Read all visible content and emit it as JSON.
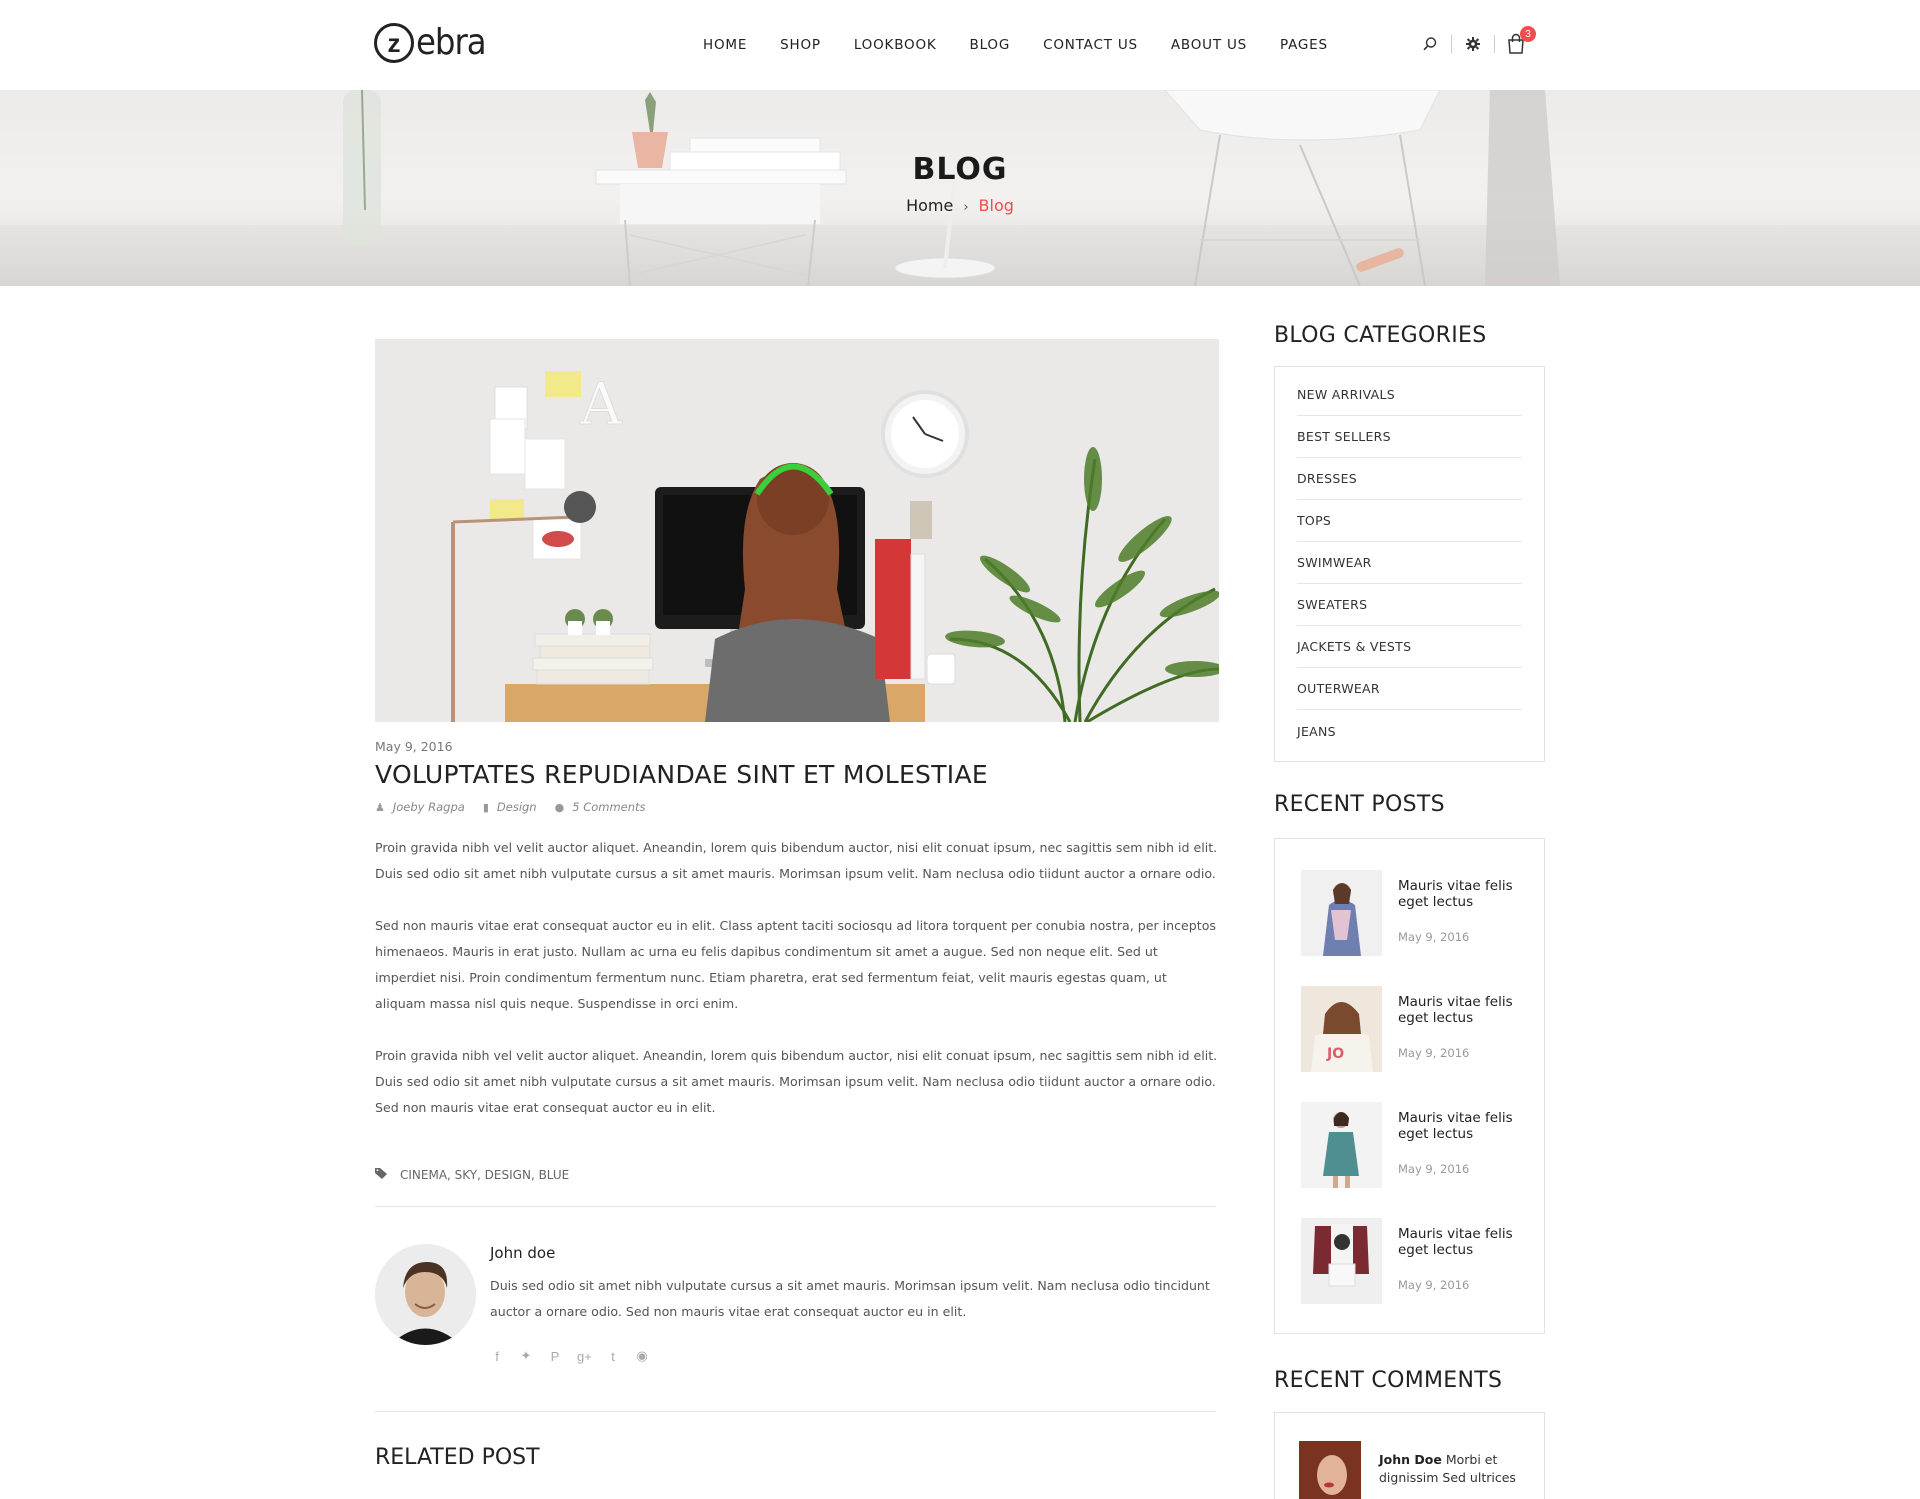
{
  "brand": {
    "logo_letter": "z",
    "logo_word": "ebra"
  },
  "nav": {
    "items": [
      "HOME",
      "SHOP",
      "LOOKBOOK",
      "BLOG",
      "CONTACT US",
      "ABOUT US",
      "PAGES"
    ]
  },
  "header_icons": {
    "search": "search-icon",
    "settings": "gear-icon",
    "cart": "cart-icon",
    "cart_count": "3"
  },
  "hero": {
    "title": "BLOG",
    "breadcrumb_home": "Home",
    "breadcrumb_sep": "›",
    "breadcrumb_current": "Blog"
  },
  "post": {
    "date": "May 9, 2016",
    "title": "VOLUPTATES REPUDIANDAE SINT ET MOLESTIAE",
    "author": "Joeby Ragpa",
    "category": "Design",
    "comments": "5 Comments",
    "paragraphs": [
      "Proin gravida nibh vel velit auctor aliquet. Aneandin, lorem quis bibendum auctor, nisi elit conuat ipsum, nec sagittis sem nibh id elit. Duis sed odio sit amet nibh vulputate cursus a sit amet mauris. Morimsan ipsum velit. Nam neclusa odio tiidunt auctor a ornare odio.",
      "Sed non  mauris vitae erat consequat auctor eu in elit. Class aptent taciti sociosqu ad litora torquent per conubia nostra, per inceptos himenaeos. Mauris in erat justo. Nullam ac urna eu felis dapibus condimentum sit amet a augue. Sed non neque elit. Sed ut imperdiet nisi. Proin condimentum fermentum nunc. Etiam pharetra, erat sed fermentum feiat, velit mauris egestas quam, ut aliquam massa nisl quis neque. Suspendisse in orci enim.",
      "Proin gravida nibh vel velit auctor aliquet. Aneandin, lorem quis bibendum auctor, nisi elit conuat ipsum, nec sagittis sem nibh id elit. Duis sed odio sit amet nibh vulputate cursus a sit amet mauris. Morimsan ipsum velit. Nam neclusa odio tiidunt auctor a ornare odio. Sed non mauris vitae erat consequat auctor eu in elit."
    ],
    "tags": "CINEMA, SKY, DESIGN, BLUE"
  },
  "author_box": {
    "name": "John doe",
    "bio": "Duis sed odio sit amet nibh vulputate cursus a sit amet mauris. Morimsan ipsum velit. Nam neclusa odio tincidunt auctor a ornare odio. Sed non  mauris vitae erat consequat auctor eu in elit.",
    "socials": [
      "facebook-icon",
      "twitter-icon",
      "pinterest-icon",
      "google-plus-icon",
      "tumblr-icon",
      "wordpress-icon"
    ]
  },
  "related": {
    "title": "RELATED POST"
  },
  "sidebar": {
    "categories_title": "BLOG CATEGORIES",
    "categories": [
      "NEW ARRIVALS",
      "BEST SELLERS",
      "DRESSES",
      "TOPS",
      "SWIMWEAR",
      "SWEATERS",
      "JACKETS & VESTS",
      "OUTERWEAR",
      "JEANS"
    ],
    "recent_posts_title": "RECENT POSTS",
    "recent_posts": [
      {
        "title": "Mauris vitae felis eget lectus",
        "date": "May 9, 2016"
      },
      {
        "title": "Mauris vitae felis eget lectus",
        "date": "May 9, 2016"
      },
      {
        "title": "Mauris vitae felis eget lectus",
        "date": "May 9, 2016"
      },
      {
        "title": "Mauris vitae felis eget lectus",
        "date": "May 9, 2016"
      }
    ],
    "recent_comments_title": "RECENT COMMENTS",
    "recent_comment": {
      "author": "John Doe",
      "text": "Morbi et dignissim Sed ultrices"
    }
  },
  "colors": {
    "accent": "#f04e4e",
    "text": "#222222",
    "muted": "#777777",
    "border": "#e3e3e3"
  }
}
